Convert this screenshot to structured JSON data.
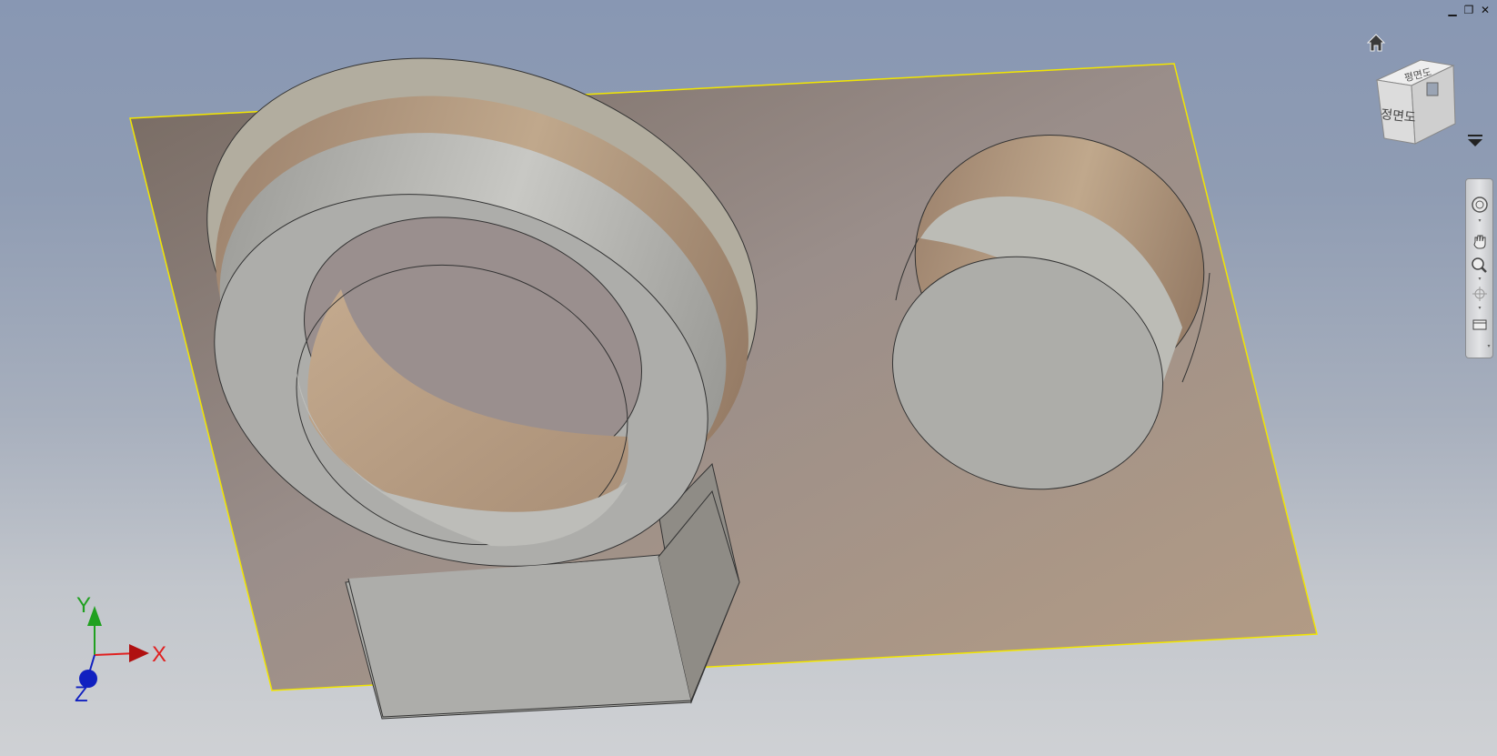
{
  "window_controls": {
    "minimize": "▁",
    "restore": "❐",
    "close": "✕"
  },
  "viewcube": {
    "front_face_label": "정면도",
    "top_face_label": "평면도"
  },
  "triad": {
    "x_label": "X",
    "y_label": "Y",
    "z_label": "Z",
    "x_color": "#e02020",
    "y_color": "#20a020",
    "z_color": "#1020c0"
  },
  "colors": {
    "sketch_plane_edge": "#f2e600",
    "plane_fill": "#a98f78",
    "part_fill": "#b8b8b4"
  },
  "navbar": {
    "items": [
      "steering-wheel-icon",
      "pan-icon",
      "zoom-icon",
      "orbit-icon",
      "look-at-icon"
    ]
  }
}
